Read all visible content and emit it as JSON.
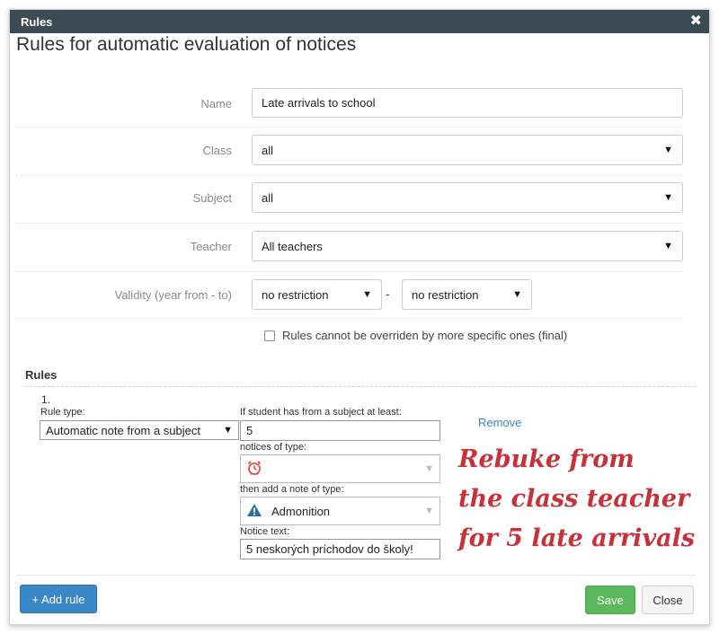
{
  "window": {
    "title": "Rules",
    "close_glyph": "✖"
  },
  "heading": "Rules for automatic evaluation of notices",
  "form": {
    "name": {
      "label": "Name",
      "value": "Late arrivals to school"
    },
    "class": {
      "label": "Class",
      "value": "all"
    },
    "subject": {
      "label": "Subject",
      "value": "all"
    },
    "teacher": {
      "label": "Teacher",
      "value": "All teachers"
    },
    "validity": {
      "label": "Validity (year from - to)",
      "from": "no restriction",
      "to": "no restriction",
      "separator": "-"
    },
    "final_checkbox": {
      "label": "Rules cannot be overriden by more specific ones (final)",
      "checked": false
    }
  },
  "rules_section": {
    "title": "Rules",
    "rules": [
      {
        "number": "1.",
        "rule_type_label": "Rule type:",
        "rule_type_value": "Automatic note from a subject",
        "at_least_label": "If student has from a subject at least:",
        "at_least_value": "5",
        "notices_type_label": "notices of type:",
        "notices_type_icon": "alarm-clock-icon",
        "note_type_label": "then add a note of type:",
        "note_type_value": "Admonition",
        "note_type_icon": "warning-triangle-icon",
        "notice_text_label": "Notice text:",
        "notice_text_value": "5 neskorých príchodov do školy!",
        "remove_label": "Remove"
      }
    ]
  },
  "annotation": {
    "line1": "Rebuke from",
    "line2": "the class teacher",
    "line3": "for 5 late arrivals"
  },
  "buttons": {
    "add_rule": "+ Add rule",
    "save": "Save",
    "close": "Close"
  },
  "colors": {
    "titlebar": "#3c4a54",
    "primary": "#3a87c8",
    "success": "#5cb85c",
    "annotation": "#c8303a"
  }
}
